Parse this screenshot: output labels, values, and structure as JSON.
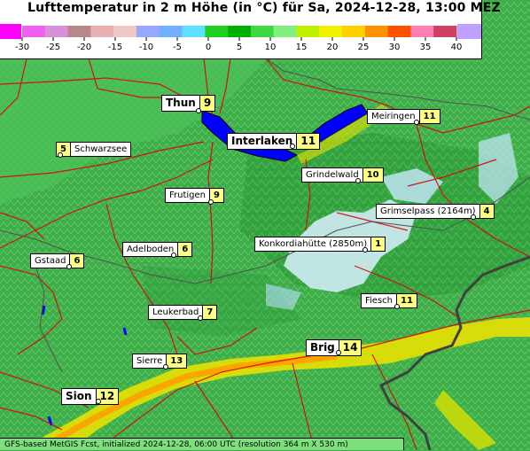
{
  "title": "Lufttemperatur in 2 m Höhe (in °C) für Sa, 2024-12-28, 13:00 MEZ",
  "footer": "GFS-based MetGIS Fcst, initialized 2024-12-28, 06:00 UTC  (resolution 364 m X 530 m)",
  "scale": {
    "ticks": [
      "-30",
      "-25",
      "-20",
      "-15",
      "-10",
      "-5",
      "0",
      "5",
      "10",
      "15",
      "20",
      "25",
      "30",
      "35",
      "40"
    ],
    "colors": [
      "#ff00ff",
      "#f45cf4",
      "#d694d6",
      "#c09090",
      "#e0b8b8",
      "#b0b8ff",
      "#8ec8ff",
      "#80ffff",
      "#00c000",
      "#30e030",
      "#80ff80",
      "#c0ff40",
      "#ffff00",
      "#ffc800",
      "#ff8000",
      "#ff4000",
      "#ff0000",
      "#ff80c0",
      "#c0c0ff"
    ],
    "colors_list": [
      "#ff00ff",
      "#f060f0",
      "#d890d8",
      "#b88888",
      "#e8b0b0",
      "#f0c8c8",
      "#98a8ff",
      "#70b0ff",
      "#60e0ff",
      "#20d020",
      "#00b000",
      "#40d840",
      "#80f080",
      "#c0f000",
      "#f0f000",
      "#ffd000",
      "#ff9000",
      "#ff5000",
      "#ff80b0",
      "#d04060",
      "#c0a0ff"
    ]
  },
  "locations": [
    {
      "name": "Thun",
      "value": "9",
      "big": true
    },
    {
      "name": "Interlaken",
      "value": "11",
      "big": true
    },
    {
      "name": "Meiringen",
      "value": "11"
    },
    {
      "name": "Schwarzsee",
      "value": "5",
      "valueFirst": true
    },
    {
      "name": "Grindelwald",
      "value": "10"
    },
    {
      "name": "Frutigen",
      "value": "9"
    },
    {
      "name": "Grimselpass (2164m)",
      "value": "4"
    },
    {
      "name": "Konkordiahütte (2850m)",
      "value": "1"
    },
    {
      "name": "Adelboden",
      "value": "6"
    },
    {
      "name": "Gstaad",
      "value": "6"
    },
    {
      "name": "Fiesch",
      "value": "11"
    },
    {
      "name": "Leukerbad",
      "value": "7"
    },
    {
      "name": "Brig",
      "value": "14",
      "big": true
    },
    {
      "name": "Sierre",
      "value": "13"
    },
    {
      "name": "Sion",
      "value": "12",
      "big": true
    }
  ],
  "colors": {
    "lake": "#0000ff",
    "valley_warm": "#f0e000",
    "rhone_valley": "#ffa000",
    "snow": "#d8f0ff",
    "roads": "#e00000",
    "border": "#404040"
  }
}
